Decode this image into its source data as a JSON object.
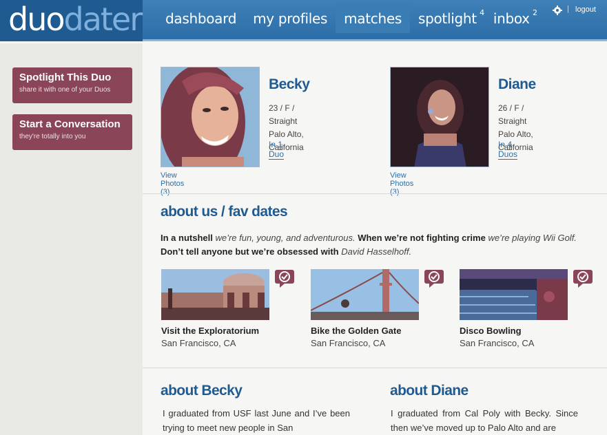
{
  "logo": {
    "part1": "duo",
    "part2": "dater"
  },
  "nav": {
    "items": [
      {
        "label": "dashboard",
        "badge": ""
      },
      {
        "label": "my profiles",
        "badge": ""
      },
      {
        "label": "matches",
        "badge": ""
      },
      {
        "label": "spotlight",
        "badge": "4"
      },
      {
        "label": "inbox",
        "badge": "2"
      }
    ],
    "active": "matches",
    "separator": "|",
    "logout": "logout"
  },
  "sidebar": {
    "spotlight": {
      "title": "Spotlight This Duo",
      "subtitle": "share it with one of your Duos"
    },
    "conversation": {
      "title": "Start a Conversation",
      "subtitle": "they're totally into you"
    }
  },
  "profiles": [
    {
      "name": "Becky",
      "meta": "23 / F /  Straight",
      "location": "Palo Alto, California",
      "in_prefix": "In ",
      "duos": "1 Duo",
      "view_photos": "View Photos (3)"
    },
    {
      "name": "Diane",
      "meta": "26 / F /  Straight",
      "location": "Palo Alto, California",
      "in_prefix": "In ",
      "duos": "4 Duos",
      "view_photos": "View Photos (3)"
    }
  ],
  "about_us": {
    "title": "about us / fav dates",
    "nutshell": [
      {
        "b": "In a nutshell",
        "i": "we’re fun, young, and adventurous."
      },
      {
        "b": "When we’re not fighting crime",
        "i": "we’re playing Wii Golf."
      },
      {
        "b": "Don’t tell anyone but we’re obsessed with",
        "i": "David Hasselhoff."
      }
    ]
  },
  "dates": [
    {
      "title": "Visit the Exploratorium",
      "location": "San Francisco, CA",
      "icon": "check-bubble-icon"
    },
    {
      "title": "Bike the Golden Gate",
      "location": "San Francisco, CA",
      "icon": "check-bubble-icon"
    },
    {
      "title": "Disco Bowling",
      "location": "San Francisco, CA",
      "icon": "check-bubble-icon"
    }
  ],
  "about_becky": {
    "title": "about Becky",
    "text": "I graduated from USF last June and I’ve been trying to meet new people in San"
  },
  "about_diane": {
    "title": "about Diane",
    "text": "I graduated from Cal Poly with Becky. Since then we’ve moved up to Palo Alto and are"
  },
  "colors": {
    "brand_blue": "#2d6ea8",
    "sidebar_button": "#8a4658",
    "title_blue": "#1f5a91"
  }
}
